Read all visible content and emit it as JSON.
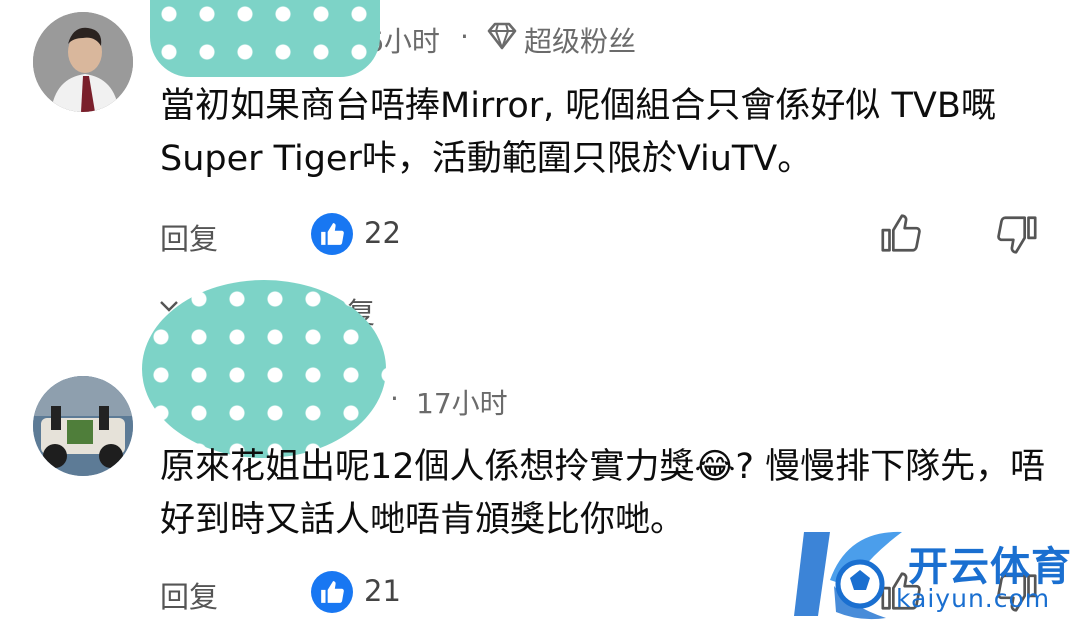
{
  "comment1": {
    "username_visible": "․",
    "time": "6小时",
    "separator": "·",
    "badge_label": "超级粉丝",
    "text": "當初如果商台唔捧Mirror, 呢個組合只會係好似 TVB嘅Super Tiger咔，活動範圍只限於ViuTV。",
    "reply_label": "回复",
    "like_count": "22",
    "view_replies_label": "复"
  },
  "comment2": {
    "separator": "·",
    "time": "17小时",
    "text": "原來花姐出呢12個人係想拎實力獎😂? 慢慢排下隊先，唔好到時又話人哋唔肯頒獎比你哋。",
    "reply_label": "回复",
    "like_count": "21"
  },
  "watermark": {
    "brand": "开云体育",
    "domain": "kaiyun.com"
  },
  "colors": {
    "like_blue": "#1877f2",
    "mask_teal": "#7dd3c7",
    "meta_gray": "#6b6b6b",
    "watermark_blue": "#1a6fd0"
  }
}
